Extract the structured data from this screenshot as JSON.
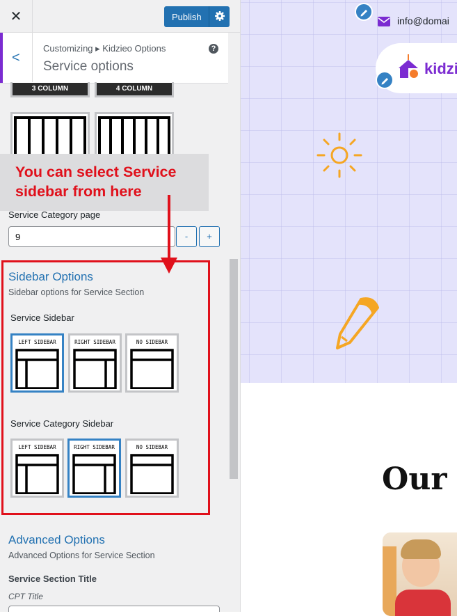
{
  "topbar": {
    "close_icon": "close-icon",
    "publish_label": "Publish"
  },
  "header": {
    "breadcrumb": "Customizing ▸ Kidzieo Options",
    "title": "Service options"
  },
  "columns": {
    "opt3_label": "3 COLUMN",
    "opt4_label": "4 COLUMN"
  },
  "callout": {
    "text": "You can select Service sidebar from here"
  },
  "category_page": {
    "label": "Service Category page",
    "value": "9",
    "minus": "-",
    "plus": "+"
  },
  "sidebar_options": {
    "title": "Sidebar Options",
    "desc": "Sidebar options for Service Section",
    "service_sidebar": {
      "label": "Service Sidebar",
      "options": [
        {
          "label": "LEFT SIDEBAR",
          "selected": true
        },
        {
          "label": "RIGHT SIDEBAR",
          "selected": false
        },
        {
          "label": "NO SIDEBAR",
          "selected": false
        }
      ]
    },
    "category_sidebar": {
      "label": "Service Category Sidebar",
      "options": [
        {
          "label": "LEFT SIDEBAR",
          "selected": false
        },
        {
          "label": "RIGHT SIDEBAR",
          "selected": true
        },
        {
          "label": "NO SIDEBAR",
          "selected": false
        }
      ]
    }
  },
  "advanced": {
    "title": "Advanced Options",
    "desc": "Advanced Options for Service Section",
    "field_label": "Service Section Title",
    "field_sublabel": "CPT Title"
  },
  "preview": {
    "email": "info@domai",
    "logo_text": "kidzi",
    "heading": "Our I"
  },
  "colors": {
    "accent": "#2271b1",
    "callout_red": "#e0101b",
    "brand_purple": "#7b2bd1",
    "orange": "#f5a623"
  }
}
